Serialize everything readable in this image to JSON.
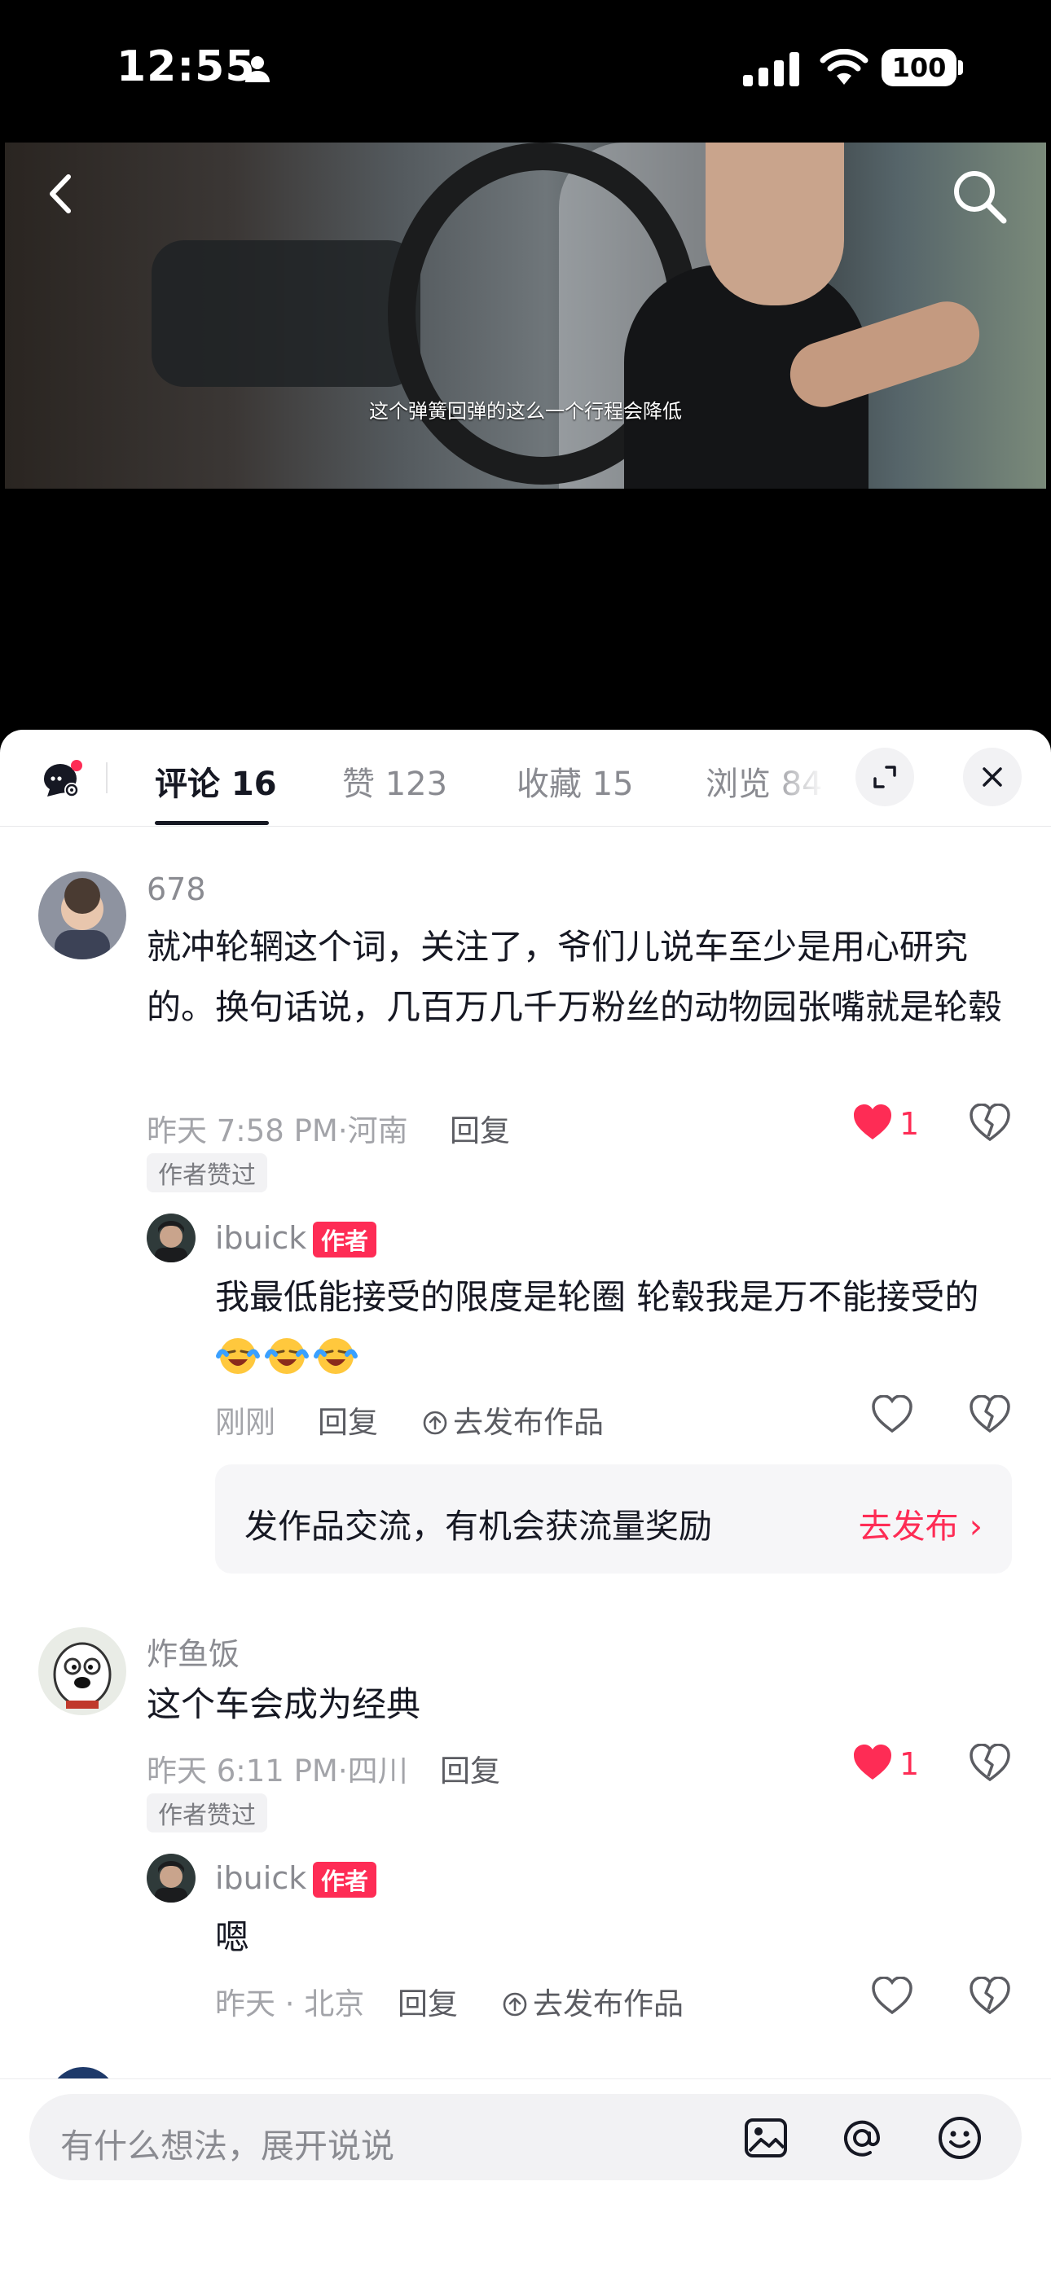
{
  "status_bar": {
    "time": "12:55",
    "battery": "100"
  },
  "video": {
    "subtitle": "这个弹簧回弹的这么一个行程会降低"
  },
  "tabs": [
    {
      "label": "评论 16"
    },
    {
      "label": "赞 123"
    },
    {
      "label": "收藏 15"
    },
    {
      "label": "浏览 84"
    }
  ],
  "comments": [
    {
      "user": "678",
      "text": "就冲轮辋这个词，关注了，爷们儿说车至少是用心研究的。换句话说，几百万几千万粉丝的动物园张嘴就是轮毂",
      "time": "昨天 7:58 PM·河南",
      "reply_label": "回复",
      "likes": "1",
      "badge": "作者赞过",
      "reply": {
        "user": "ibuick",
        "tag": "作者",
        "text": "我最低能接受的限度是轮圈 轮毂我是万不能接受的",
        "time": "刚刚",
        "reply_label": "回复",
        "publish_label": "去发布作品"
      }
    },
    {
      "user": "炸鱼饭",
      "text": "这个车会成为经典",
      "time": "昨天 6:11 PM·四川",
      "reply_label": "回复",
      "likes": "1",
      "badge": "作者赞过",
      "reply": {
        "user": "ibuick",
        "tag": "作者",
        "text": "嗯",
        "time": "昨天 · 北京",
        "reply_label": "回复",
        "publish_label": "去发布作品"
      }
    }
  ],
  "promo": {
    "text": "发作品交流，有机会获流量奖励",
    "link": "去发布 ›"
  },
  "input": {
    "placeholder": "有什么想法，展开说说"
  },
  "colors": {
    "accent": "#fe2c55",
    "text": "#161823",
    "muted": "#8a8b91"
  }
}
